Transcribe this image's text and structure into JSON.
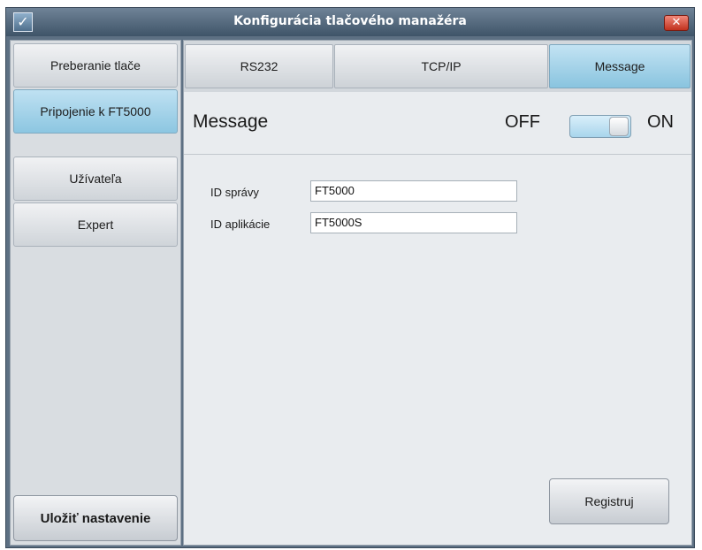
{
  "window": {
    "title": "Konfigurácia tlačového manažéra",
    "app_icon": "checkmark-icon",
    "close_icon": "close-icon",
    "app_icon_glyph": "✓",
    "close_glyph": "✕"
  },
  "sidebar": {
    "items": [
      {
        "label": "Preberanie tlače",
        "active": false
      },
      {
        "label": "Pripojenie k FT5000",
        "active": true
      },
      {
        "label": "Užívateľa",
        "active": false
      },
      {
        "label": "Expert",
        "active": false
      }
    ],
    "save_label": "Uložiť nastavenie"
  },
  "tabs": [
    {
      "label": "RS232",
      "active": false
    },
    {
      "label": "TCP/IP",
      "active": false
    },
    {
      "label": "Message",
      "active": true
    }
  ],
  "message": {
    "title": "Message",
    "off_label": "OFF",
    "on_label": "ON",
    "toggle_state": "ON",
    "fields": [
      {
        "label": "ID správy",
        "value": "FT5000"
      },
      {
        "label": "ID aplikácie",
        "value": "FT5000S"
      }
    ],
    "register_label": "Registruj"
  },
  "colors": {
    "accent_active": "#8cc6e1",
    "title_bar": "#4b6073",
    "close_button": "#c1321e"
  }
}
